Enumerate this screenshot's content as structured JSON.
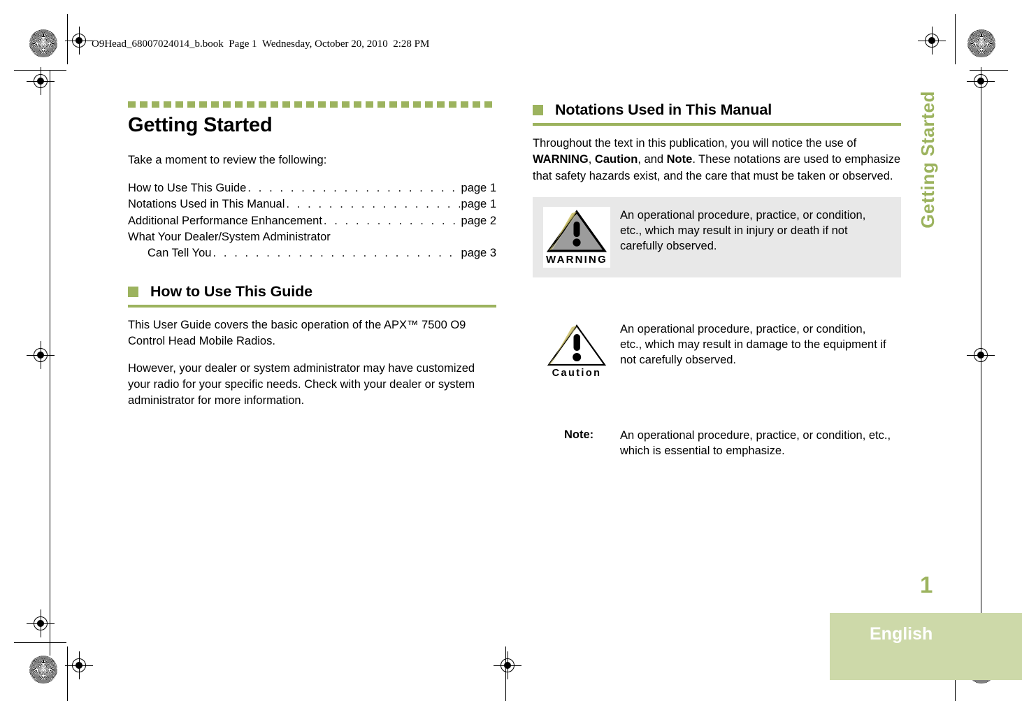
{
  "doc_header": "O9Head_68007024014_b.book  Page 1  Wednesday, October 20, 2010  2:28 PM",
  "colors": {
    "accent_green": "#9cb35e",
    "light_green": "#cdd9a9",
    "warning_bg": "#e8e8e8",
    "triangle_fill": "#9c9c9c"
  },
  "left_column": {
    "chapter_title": "Getting Started",
    "intro": "Take a moment to review the following:",
    "toc": [
      {
        "label": "How to Use This Guide",
        "page": "page 1",
        "indent": false
      },
      {
        "label": "Notations Used in This Manual",
        "page": "page 1",
        "indent": false
      },
      {
        "label": "Additional Performance Enhancement",
        "page": "page 2",
        "indent": false
      },
      {
        "label": "What Your Dealer/System Administrator",
        "page": "",
        "indent": false
      },
      {
        "label": "Can Tell You",
        "page": "page 3",
        "indent": true
      }
    ],
    "section": {
      "heading": "How to Use This Guide",
      "paragraphs": [
        "This User Guide covers the basic operation of the APX™ 7500 O9 Control Head Mobile Radios.",
        "However, your dealer or system administrator may have customized your radio for your specific needs. Check with your dealer or system administrator for more information."
      ]
    }
  },
  "right_column": {
    "section": {
      "heading": "Notations Used in This Manual",
      "intro_parts": {
        "p1": "Throughout the text in this publication, you will notice the use of ",
        "b1": "WARNING",
        "p2": ", ",
        "b2": "Caution",
        "p3": ", and ",
        "b3": "Note",
        "p4": ". These notations are used to emphasize that safety hazards exist, and the care that must be taken or observed."
      }
    },
    "notations": [
      {
        "type": "warning",
        "sign_word": "WARNING",
        "text": "An operational procedure, practice, or condition, etc., which may result in injury or death if not carefully observed."
      },
      {
        "type": "caution",
        "sign_word": "Caution",
        "text": "An operational procedure, practice, or condition, etc., which may result in damage to the equipment if not carefully observed."
      },
      {
        "type": "note",
        "sign_word": "Note:",
        "text": "An operational procedure, practice, or condition, etc., which is essential to emphasize."
      }
    ]
  },
  "side_tab": {
    "label": "Getting Started"
  },
  "footer": {
    "page_number": "1",
    "language": "English"
  },
  "leader_dots": ". . . . . . . . . . . . . . . . . . . . . . . . . . . . . . . . . . . . . . . . . . . . . . . . . . . . . . . . . . . . . . . . . . . . . . . . . . . ."
}
